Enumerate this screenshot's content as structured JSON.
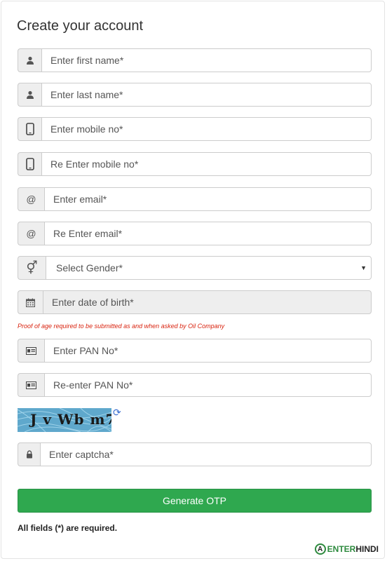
{
  "title": "Create your account",
  "fields": [
    {
      "placeholder": "Enter first name*",
      "icon": "person-icon"
    },
    {
      "placeholder": "Enter last name*",
      "icon": "person-icon"
    },
    {
      "placeholder": "Enter mobile no*",
      "icon": "mobile-icon"
    },
    {
      "placeholder": "Re Enter mobile no*",
      "icon": "mobile-icon"
    },
    {
      "placeholder": "Enter email*",
      "icon": "at-icon",
      "icon_text": "@"
    },
    {
      "placeholder": "Re Enter email*",
      "icon": "at-icon",
      "icon_text": "@"
    },
    {
      "placeholder": "Select Gender*",
      "icon": "gender-icon",
      "icon_text": "⚥"
    },
    {
      "placeholder": "Enter date of birth*",
      "icon": "calendar-icon"
    },
    {
      "placeholder": "Enter PAN No*",
      "icon": "id-card-icon"
    },
    {
      "placeholder": "Re-enter PAN No*",
      "icon": "id-card-icon"
    },
    {
      "placeholder": "Enter captcha*",
      "icon": "lock-icon"
    }
  ],
  "dob_note": "Proof of age required to be submitted as and when asked by Oil Company",
  "captcha_text": "J v Wb m7",
  "generate_button": "Generate OTP",
  "required_note": "All fields (*) are required.",
  "logo": {
    "part1": "ENTER",
    "part2": "HINDI"
  },
  "colors": {
    "button": "#2fa84f",
    "note": "#d9230f"
  }
}
